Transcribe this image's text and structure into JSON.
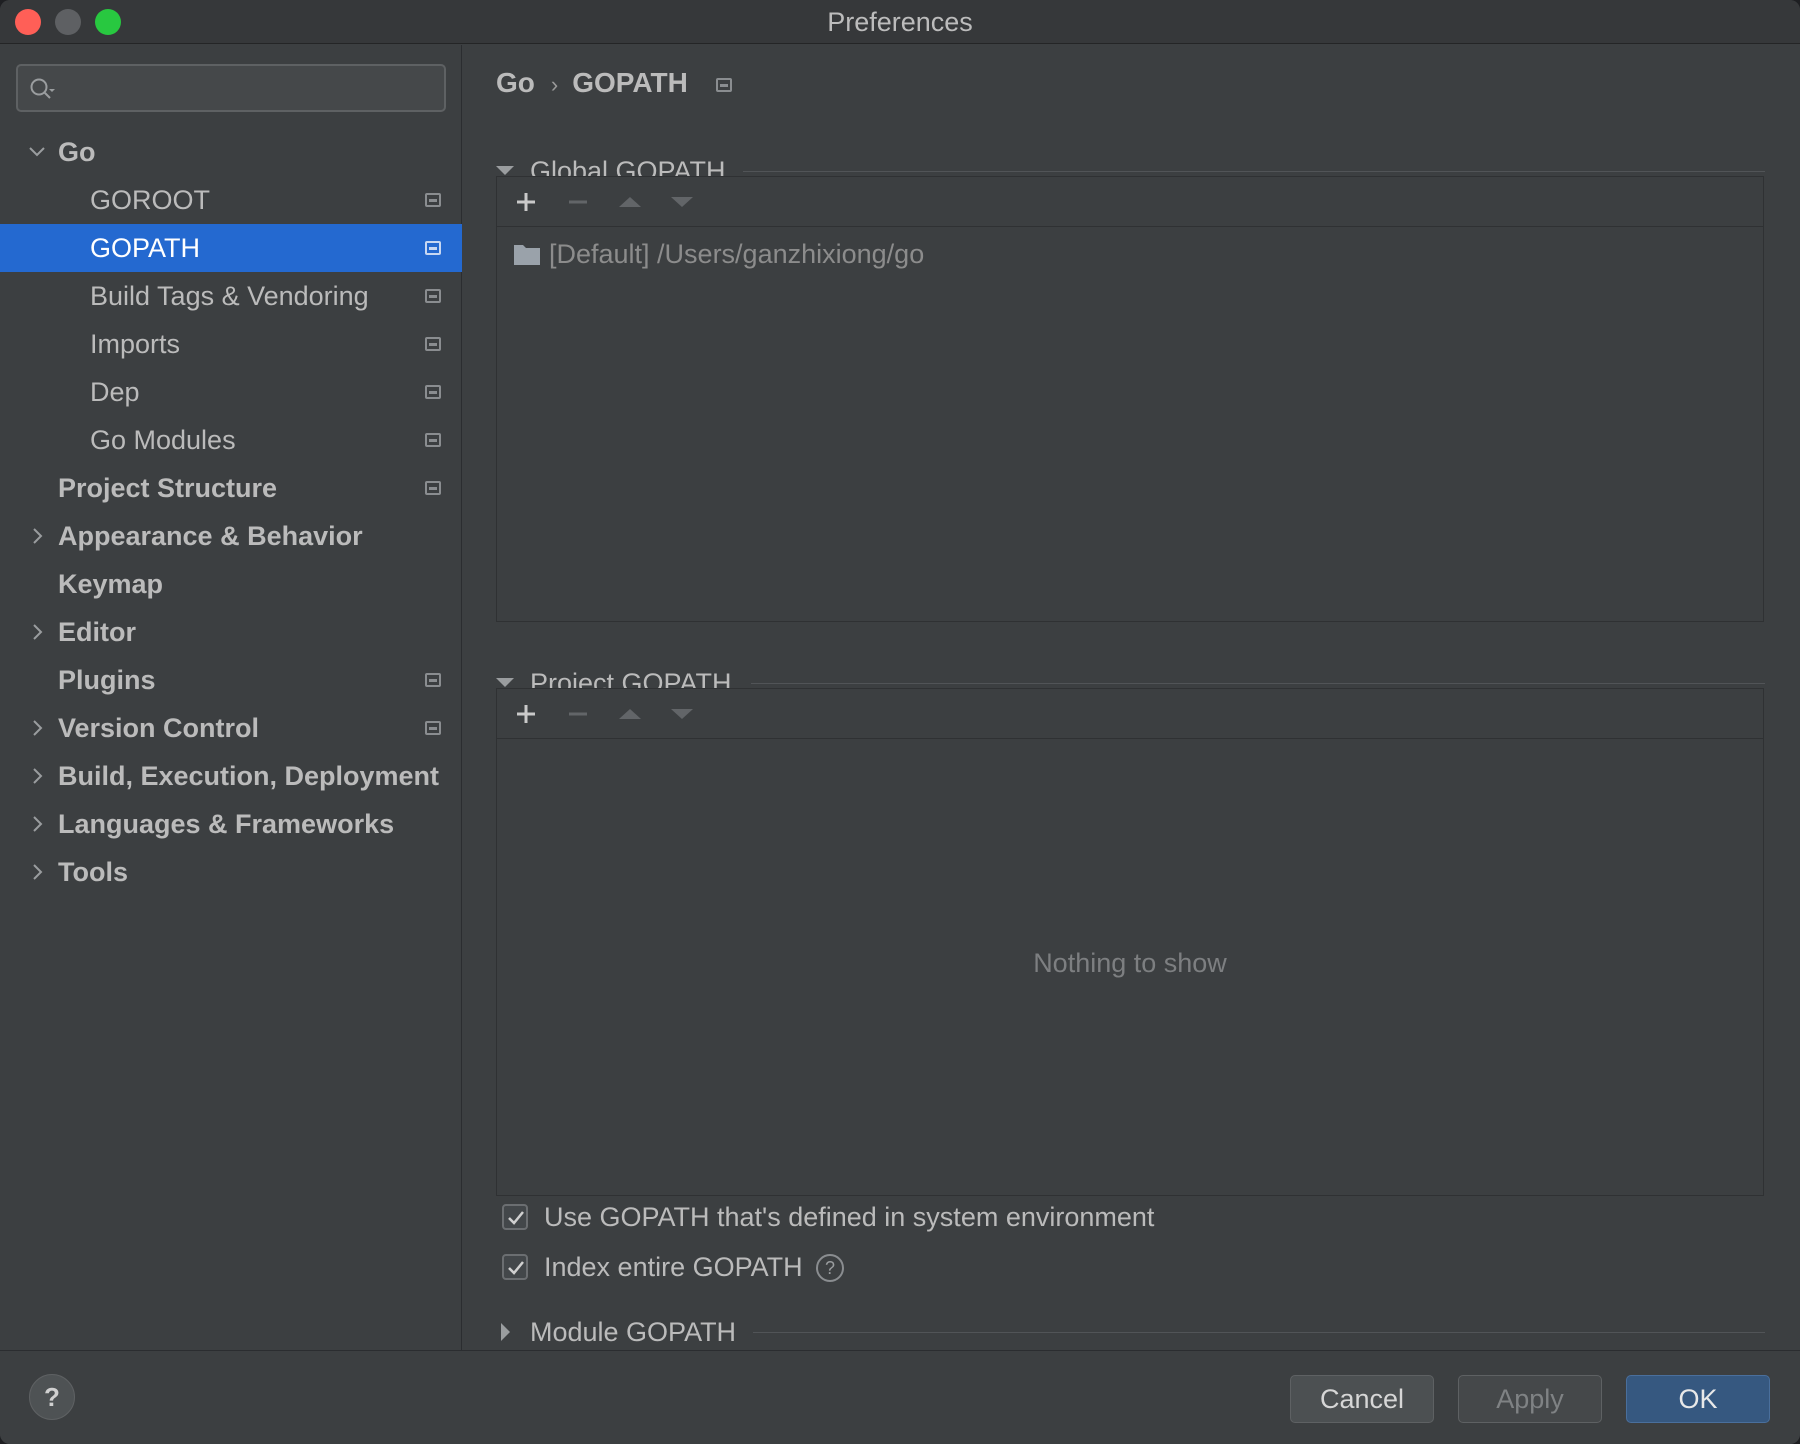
{
  "window": {
    "title": "Preferences"
  },
  "sidebar": {
    "search_placeholder": "",
    "items": [
      {
        "label": "Go",
        "level": 1,
        "expanded": true,
        "has_icon": false
      },
      {
        "label": "GOROOT",
        "level": 2,
        "has_icon": true
      },
      {
        "label": "GOPATH",
        "level": 2,
        "has_icon": true,
        "selected": true
      },
      {
        "label": "Build Tags & Vendoring",
        "level": 2,
        "has_icon": true
      },
      {
        "label": "Imports",
        "level": 2,
        "has_icon": true
      },
      {
        "label": "Dep",
        "level": 2,
        "has_icon": true
      },
      {
        "label": "Go Modules",
        "level": 2,
        "has_icon": true
      },
      {
        "label": "Project Structure",
        "level": 1,
        "has_icon": true
      },
      {
        "label": "Appearance & Behavior",
        "level": 1,
        "collapsed": true
      },
      {
        "label": "Keymap",
        "level": 1
      },
      {
        "label": "Editor",
        "level": 1,
        "collapsed": true
      },
      {
        "label": "Plugins",
        "level": 1,
        "has_icon": true
      },
      {
        "label": "Version Control",
        "level": 1,
        "collapsed": true,
        "has_icon": true
      },
      {
        "label": "Build, Execution, Deployment",
        "level": 1,
        "collapsed": true
      },
      {
        "label": "Languages & Frameworks",
        "level": 1,
        "collapsed": true
      },
      {
        "label": "Tools",
        "level": 1,
        "collapsed": true
      }
    ]
  },
  "breadcrumb": {
    "parent": "Go",
    "separator": "›",
    "current": "GOPATH"
  },
  "global_gopath": {
    "title": "Global GOPATH",
    "entries": [
      "[Default] /Users/ganzhixiong/go"
    ]
  },
  "project_gopath": {
    "title": "Project GOPATH",
    "empty_text": "Nothing to show"
  },
  "options": {
    "use_system_env": {
      "label": "Use GOPATH that's defined in system environment",
      "checked": true
    },
    "index_entire": {
      "label": "Index entire GOPATH",
      "checked": true,
      "help_glyph": "?"
    }
  },
  "module_gopath": {
    "title": "Module GOPATH"
  },
  "footer": {
    "help_glyph": "?",
    "cancel_label": "Cancel",
    "apply_label": "Apply",
    "ok_label": "OK"
  },
  "colors": {
    "background": "#3c3f41",
    "selection": "#2469d0",
    "ok_button": "#365880"
  }
}
